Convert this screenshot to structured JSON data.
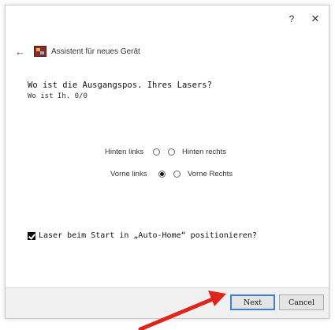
{
  "titlebar": {
    "help_label": "?",
    "close_label": "✕"
  },
  "nav": {
    "back_label": "←",
    "title": "Assistent für neues Gerät"
  },
  "question": "Wo ist die Ausgangspos. Ihres Lasers?",
  "subquestion": "Wo ist Ih. 0/0",
  "options": {
    "row1": {
      "left_label": "Hinten links",
      "right_label": "Hinten rechts",
      "left_selected": false,
      "right_selected": false
    },
    "row2": {
      "left_label": "Vorne links",
      "right_label": "Vorne Rechts",
      "left_selected": true,
      "right_selected": false
    }
  },
  "checkbox": {
    "label": "Laser beim Start in „Auto-Home“ positionieren?",
    "checked": true
  },
  "buttons": {
    "next_label": "Next",
    "cancel_label": "Cancel"
  },
  "colors": {
    "accent": "#3c7fd0",
    "annotation_arrow": "#e0241a",
    "icon": "#8a2b2b"
  },
  "icons": [
    "help-icon",
    "close-icon",
    "back-arrow-icon",
    "wizard-icon",
    "annotation-arrow"
  ]
}
